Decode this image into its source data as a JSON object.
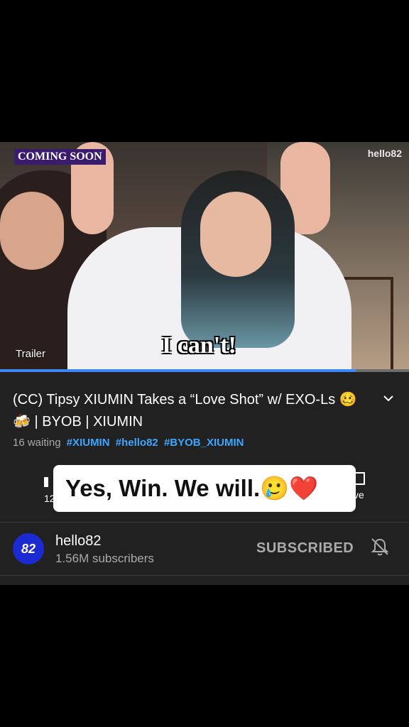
{
  "video": {
    "badge": "COMING SOON",
    "watermark": "hello82",
    "caption": "I can't!",
    "trailer_label": "Trailer",
    "progress": 0.87
  },
  "details": {
    "title": "(CC) Tipsy XIUMIN Takes a “Love Shot” w/ EXO-Ls 🥴 🍻 | BYOB | XIUMIN",
    "waiting": "16 waiting",
    "tags": [
      "#XIUMIN",
      "#hello82",
      "#BYOB_XIUMIN"
    ],
    "action_left_partial": "12",
    "action_right_partial": "ve"
  },
  "overlay_text": "Yes, Win. We will.🥲❤️",
  "channel": {
    "avatar_text": "82",
    "name": "hello82",
    "subscribers": "1.56M subscribers",
    "subscribe_label": "SUBSCRIBED",
    "bell_icon": "bell-off-icon"
  },
  "colors": {
    "accent": "#3ea6ff",
    "progress": "#3d8af7",
    "panel": "#212121",
    "badge": "#3a1b6e"
  }
}
